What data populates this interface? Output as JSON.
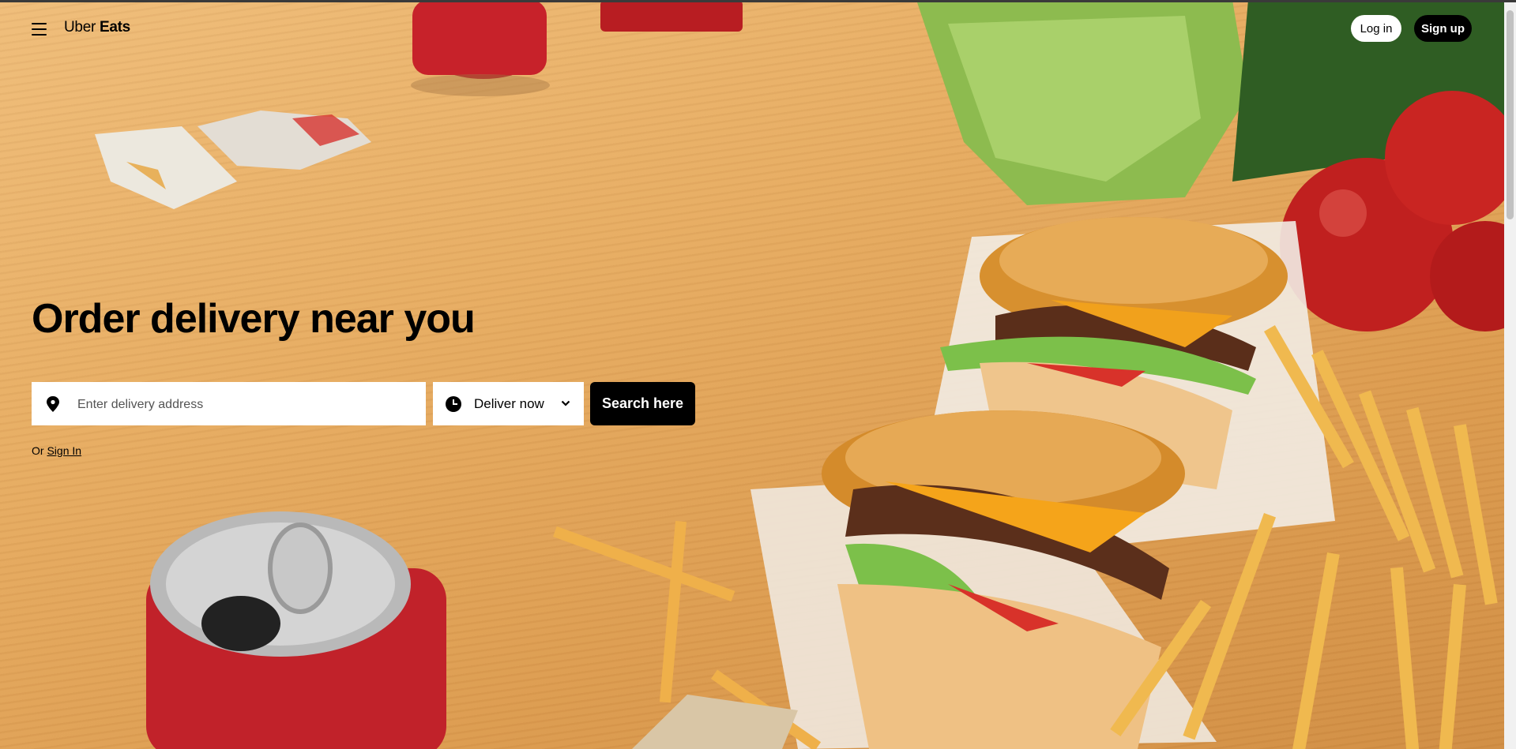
{
  "header": {
    "logo_light": "Uber",
    "logo_bold": "Eats",
    "login_label": "Log in",
    "signup_label": "Sign up"
  },
  "hero": {
    "title": "Order delivery near you",
    "address_placeholder": "Enter delivery address",
    "deliver_option": "Deliver now",
    "search_label": "Search here",
    "or_text": "Or",
    "signin_link": "Sign In"
  },
  "icons": {
    "menu": "hamburger-menu-icon",
    "address": "location-pin-icon",
    "time": "clock-icon",
    "dropdown": "chevron-down-icon"
  },
  "colors": {
    "primary": "#000000",
    "surface": "#ffffff",
    "background": "#e2a75a"
  }
}
